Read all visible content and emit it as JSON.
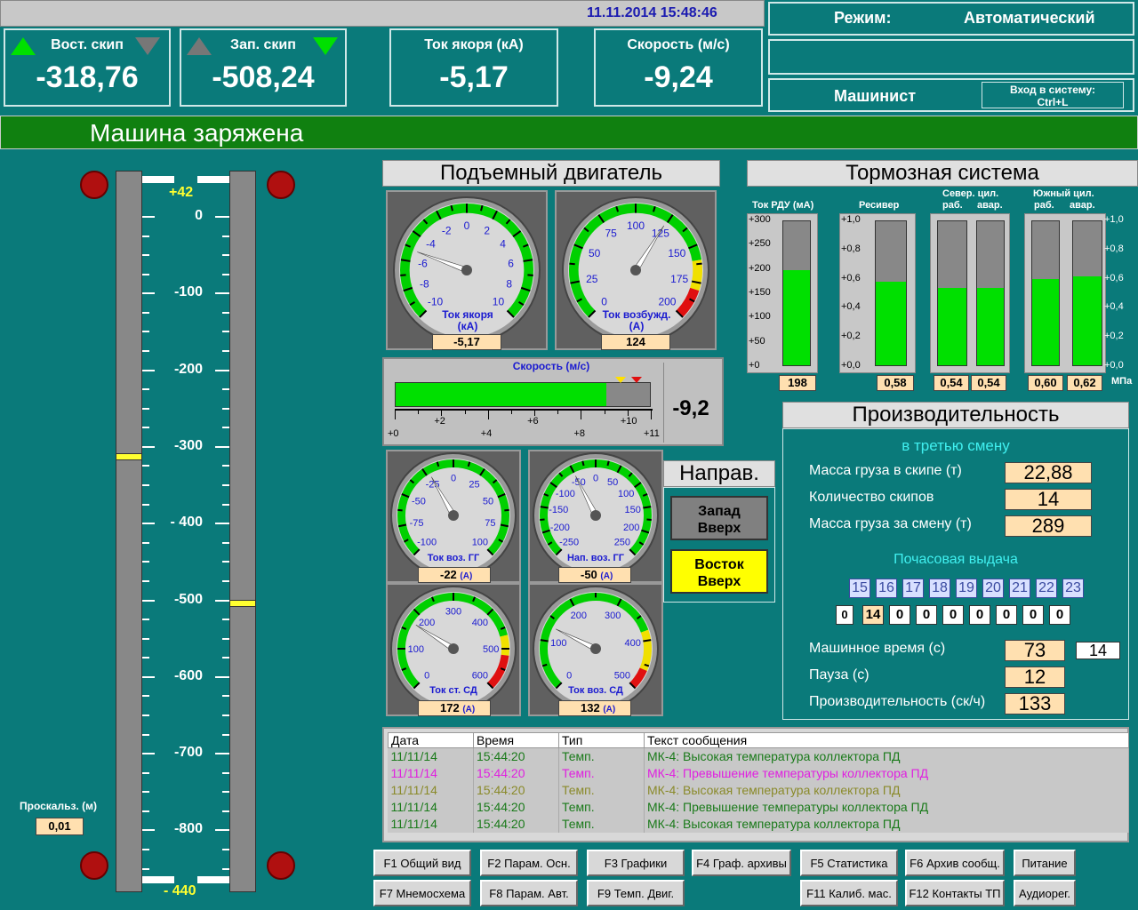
{
  "header": {
    "datetime": "11.11.2014 15:48:46",
    "mode_label": "Режим:",
    "mode_value": "Автоматический",
    "user": "Машинист",
    "login": "Вход в систему:",
    "login_key": "Ctrl+L"
  },
  "top_values": [
    {
      "label": "Вост. скип",
      "value": "-318,76"
    },
    {
      "label": "Зап. скип",
      "value": "-508,24"
    },
    {
      "label": "Ток якоря (кА)",
      "value": "-5,17"
    },
    {
      "label": "Скорость (м/с)",
      "value": "-9,24"
    }
  ],
  "status_banner": "Машина заряжена",
  "shaft": {
    "top_mark": "+42",
    "bottom_mark": "- 440",
    "ticks": [
      "0",
      "-100",
      "-200",
      "-300",
      "- 400",
      "-500",
      "-600",
      "-700",
      "-800"
    ],
    "slip_label": "Проскальз. (м)",
    "slip_value": "0,01"
  },
  "motor": {
    "title": "Подъемный двигатель",
    "g1": {
      "label1": "Ток якоря",
      "label2": "(кА)",
      "value": "-5,17",
      "scale": [
        "-10",
        "-8",
        "-6",
        "-4",
        "-2",
        "0",
        "2",
        "4",
        "6",
        "8",
        "10"
      ]
    },
    "g2": {
      "label1": "Ток возбужд.",
      "label2": "(А)",
      "value": "124",
      "scale": [
        "0",
        "25",
        "50",
        "75",
        "100",
        "125",
        "150",
        "175",
        "200"
      ]
    }
  },
  "speed": {
    "title": "Скорость (м/с)",
    "value": "-9,2",
    "fill_fraction": 0.83,
    "ticks": [
      "+0",
      "+2",
      "+4",
      "+6",
      "+8",
      "+10",
      "+11"
    ]
  },
  "small_gauges": [
    {
      "label": "Ток воз. ГГ",
      "value": "-22",
      "unit": "(А)",
      "scale": [
        "-100",
        "-75",
        "-50",
        "-25",
        "0",
        "25",
        "50",
        "75",
        "100"
      ]
    },
    {
      "label": "Нап. воз. ГГ",
      "value": "-50",
      "unit": "(А)",
      "scale": [
        "-250",
        "-200",
        "-150",
        "-100",
        "-50",
        "0",
        "50",
        "100",
        "150",
        "200",
        "250"
      ]
    },
    {
      "label": "Ток ст. СД",
      "value": "172",
      "unit": "(А)",
      "scale": [
        "0",
        "100",
        "200",
        "300",
        "400",
        "500",
        "600"
      ]
    },
    {
      "label": "Ток воз. СД",
      "value": "132",
      "unit": "(А)",
      "scale": [
        "0",
        "100",
        "200",
        "300",
        "400",
        "500"
      ]
    }
  ],
  "direction": {
    "title": "Направ.",
    "west_up": "Запад Вверх",
    "east_up": "Восток Вверх"
  },
  "brakes": {
    "title": "Тормозная система",
    "col_rdu": "Ток РДУ (мА)",
    "col_res": "Ресивер",
    "col_north": "Север. цил.",
    "col_south": "Южный цил.",
    "sub_work": "раб.",
    "sub_alarm": "авар.",
    "rdu_ticks": [
      "+300",
      "+250",
      "+200",
      "+150",
      "+100",
      "+50",
      "+0"
    ],
    "mpa_ticks": [
      "+1,0",
      "+0,8",
      "+0,6",
      "+0,4",
      "+0,2",
      "+0,0"
    ],
    "unit": "МПа",
    "values": {
      "rdu": "198",
      "res": "0,58",
      "n1": "0,54",
      "n2": "0,54",
      "s1": "0,60",
      "s2": "0,62"
    },
    "fill": {
      "rdu": 0.66,
      "res": 0.58,
      "n1": 0.54,
      "n2": 0.54,
      "s1": 0.6,
      "s2": 0.62
    }
  },
  "productivity": {
    "title": "Производительность",
    "shift": "в третью смену",
    "rows": [
      {
        "label": "Масса груза в скипе (т)",
        "value": "22,88"
      },
      {
        "label": "Количество скипов",
        "value": "14"
      },
      {
        "label": "Масса груза за смену (т)",
        "value": "289"
      }
    ],
    "hourly_title": "Почасовая выдача",
    "hours": [
      "15",
      "16",
      "17",
      "18",
      "19",
      "20",
      "21",
      "22",
      "23"
    ],
    "hourly": [
      "0",
      "14",
      "0",
      "0",
      "0",
      "0",
      "0",
      "0",
      "0"
    ],
    "machine_time_label": "Машинное время (с)",
    "machine_time": "73",
    "machine_time2": "14",
    "pause_label": "Пауза (с)",
    "pause": "12",
    "perf_label": "Производительность (ск/ч)",
    "perf": "133"
  },
  "log": {
    "headers": [
      "Дата",
      "Время",
      "Тип",
      "Текст сообщения"
    ],
    "rows": [
      {
        "d": "11/11/14",
        "t": "15:44:20",
        "ty": "Темп.",
        "m": "МК-4: Высокая температура коллектора ПД",
        "c": "#1a7a1a"
      },
      {
        "d": "11/11/14",
        "t": "15:44:20",
        "ty": "Темп.",
        "m": "МК-4: Превышение температуры коллектора ПД",
        "c": "#e020e0"
      },
      {
        "d": "11/11/14",
        "t": "15:44:20",
        "ty": "Темп.",
        "m": "МК-4: Высокая температура коллектора ПД",
        "c": "#8a8a2a"
      },
      {
        "d": "11/11/14",
        "t": "15:44:20",
        "ty": "Темп.",
        "m": "МК-4: Превышение температуры коллектора ПД",
        "c": "#1a7a1a"
      },
      {
        "d": "11/11/14",
        "t": "15:44:20",
        "ty": "Темп.",
        "m": "МК-4: Высокая температура коллектора ПД",
        "c": "#1a7a1a"
      }
    ]
  },
  "fkeys": [
    "F1 Общий вид",
    "F2 Парам. Осн.",
    "F3 Графики",
    "F4 Граф. архивы",
    "F5 Статистика",
    "F6 Архив сообщ.",
    "Питание",
    "F7 Мнемосхема",
    "F8 Парам. Авт.",
    "F9 Темп. Двиг.",
    "F11 Калиб. мас.",
    "F12 Контакты ТП",
    "Аудиорег."
  ]
}
